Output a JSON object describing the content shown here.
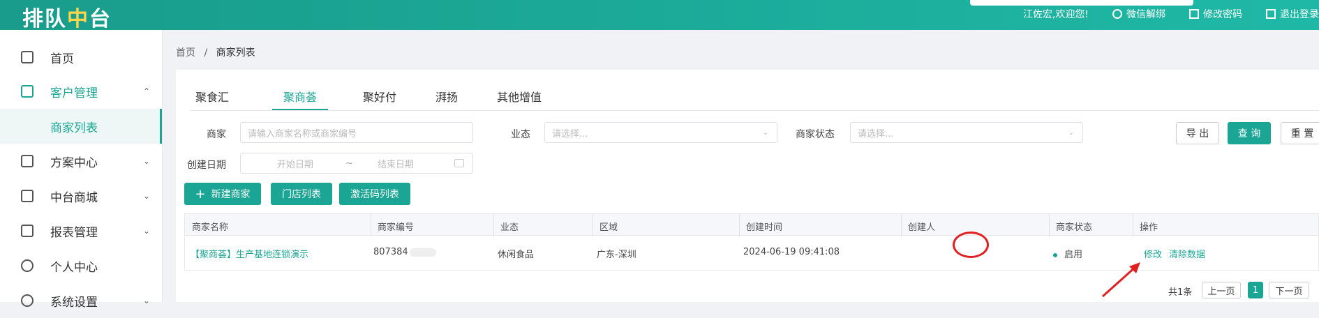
{
  "header": {
    "logo_a": "排队",
    "logo_b": "中",
    "logo_c": "台",
    "welcome": "江佐宏,欢迎您!",
    "wechat_unbind": "微信解绑",
    "change_password": "修改密码",
    "logout": "退出登录"
  },
  "sidebar": {
    "items": [
      {
        "label": "首页"
      },
      {
        "label": "客户管理"
      },
      {
        "label": "商家列表"
      },
      {
        "label": "方案中心"
      },
      {
        "label": "中台商城"
      },
      {
        "label": "报表管理"
      },
      {
        "label": "个人中心"
      },
      {
        "label": "系统设置"
      }
    ]
  },
  "breadcrumb": {
    "home": "首页",
    "sep": "/",
    "current": "商家列表"
  },
  "tabs": [
    "聚食汇",
    "聚商荟",
    "聚好付",
    "湃扬",
    "其他增值"
  ],
  "filters": {
    "merchant_label": "商家",
    "merchant_placeholder": "请输入商家名称或商家编号",
    "format_label": "业态",
    "format_placeholder": "请选择...",
    "status_label": "商家状态",
    "status_placeholder": "请选择...",
    "date_label": "创建日期",
    "start_placeholder": "开始日期",
    "range_sep": "~",
    "end_placeholder": "结束日期"
  },
  "actions": {
    "export": "导 出",
    "query": "查 询",
    "reset": "重 置",
    "new_merchant": "新建商家",
    "store_list": "门店列表",
    "activation_list": "激活码列表"
  },
  "table": {
    "headers": [
      "商家名称",
      "商家编号",
      "业态",
      "区域",
      "创建时间",
      "创建人",
      "商家状态",
      "操作"
    ],
    "rows": [
      {
        "name": "【聚商荟】生产基地连锁演示",
        "code": "807384",
        "format": "休闲食品",
        "region": "广东-深圳",
        "created": "2024-06-19 09:41:08",
        "creator": "",
        "status": "启用",
        "edit": "修改",
        "clear": "清除数据"
      }
    ]
  },
  "pagination": {
    "total": "共1条",
    "prev": "上一页",
    "page": "1",
    "next": "下一页"
  },
  "colors": {
    "brand": "#1aa594",
    "annotation": "#e02020"
  }
}
